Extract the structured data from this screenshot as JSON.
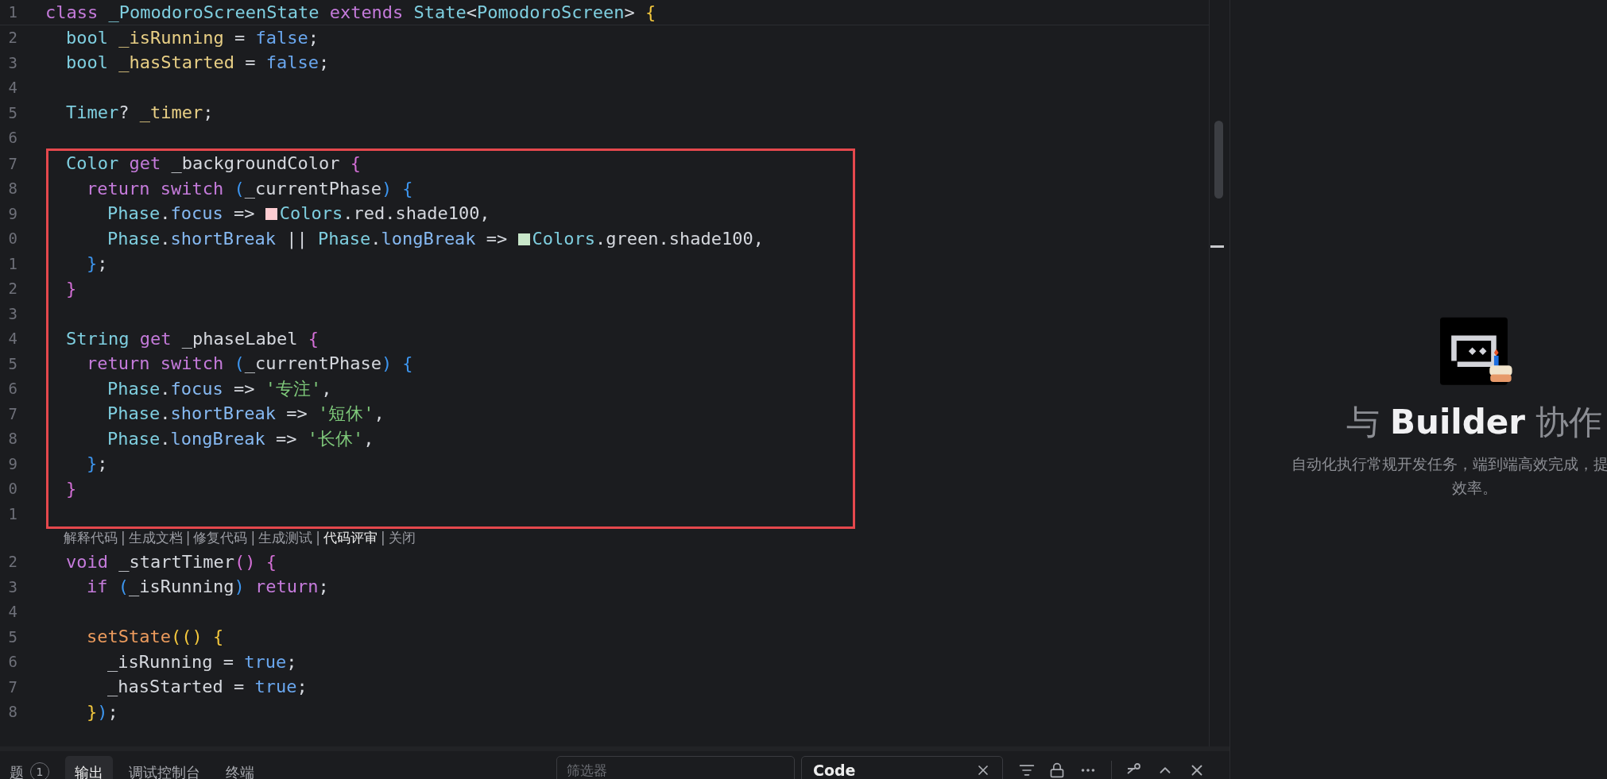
{
  "editor": {
    "sticky_line": {
      "number": "1",
      "tokens": [
        {
          "kind": "kw",
          "t": "class "
        },
        {
          "kind": "cls",
          "t": "_PomodoroScreenState "
        },
        {
          "kind": "kw",
          "t": "extends "
        },
        {
          "kind": "type",
          "t": "State"
        },
        {
          "kind": "id",
          "t": "<"
        },
        {
          "kind": "type",
          "t": "PomodoroScreen"
        },
        {
          "kind": "id",
          "t": "> "
        },
        {
          "kind": "b1",
          "t": "{"
        }
      ]
    },
    "sections": [
      {
        "kind": "plain",
        "lines": [
          {
            "number": "2",
            "tokens": [
              {
                "kind": "type",
                "t": "bool "
              },
              {
                "kind": "var",
                "t": "_isRunning"
              },
              {
                "kind": "id",
                "t": " = "
              },
              {
                "kind": "lit",
                "t": "false"
              },
              {
                "kind": "id",
                "t": ";"
              }
            ]
          },
          {
            "number": "3",
            "tokens": [
              {
                "kind": "type",
                "t": "bool "
              },
              {
                "kind": "var",
                "t": "_hasStarted"
              },
              {
                "kind": "id",
                "t": " = "
              },
              {
                "kind": "lit",
                "t": "false"
              },
              {
                "kind": "id",
                "t": ";"
              }
            ]
          },
          {
            "number": "4"
          },
          {
            "number": "5",
            "tokens": [
              {
                "kind": "type",
                "t": "Timer"
              },
              {
                "kind": "id",
                "t": "? "
              },
              {
                "kind": "var",
                "t": "_timer"
              },
              {
                "kind": "id",
                "t": ";"
              }
            ]
          },
          {
            "number": "6"
          }
        ]
      },
      {
        "kind": "highlighted",
        "lines": [
          {
            "number": "7",
            "tokens": [
              {
                "kind": "type",
                "t": "Color "
              },
              {
                "kind": "kw",
                "t": "get "
              },
              {
                "kind": "id",
                "t": "_backgroundColor "
              },
              {
                "kind": "b2",
                "t": "{"
              }
            ],
            "children": [
              {
                "number": "8",
                "tokens": [
                  {
                    "kind": "kw",
                    "t": "return switch "
                  },
                  {
                    "kind": "b3",
                    "t": "("
                  },
                  {
                    "kind": "id",
                    "t": "_currentPhase"
                  },
                  {
                    "kind": "b3",
                    "t": ") {"
                  }
                ],
                "children": [
                  {
                    "number": "9",
                    "tokens": [
                      {
                        "kind": "cls",
                        "t": "Phase"
                      },
                      {
                        "kind": "id",
                        "t": "."
                      },
                      {
                        "kind": "prop",
                        "t": "focus"
                      },
                      {
                        "kind": "id",
                        "t": " => "
                      },
                      {
                        "kind": "swatch",
                        "color": "#ffcdd2"
                      },
                      {
                        "kind": "cls",
                        "t": "Colors"
                      },
                      {
                        "kind": "id",
                        "t": ".red.shade100,"
                      }
                    ]
                  },
                  {
                    "number": "0",
                    "tokens": [
                      {
                        "kind": "cls",
                        "t": "Phase"
                      },
                      {
                        "kind": "id",
                        "t": "."
                      },
                      {
                        "kind": "prop",
                        "t": "shortBreak"
                      },
                      {
                        "kind": "id",
                        "t": " || "
                      },
                      {
                        "kind": "cls",
                        "t": "Phase"
                      },
                      {
                        "kind": "id",
                        "t": "."
                      },
                      {
                        "kind": "prop",
                        "t": "longBreak"
                      },
                      {
                        "kind": "id",
                        "t": " => "
                      },
                      {
                        "kind": "swatch",
                        "color": "#c8e6c9"
                      },
                      {
                        "kind": "cls",
                        "t": "Colors"
                      },
                      {
                        "kind": "id",
                        "t": ".green.shade100,"
                      }
                    ]
                  }
                ]
              },
              {
                "number": "1",
                "tokens": [
                  {
                    "kind": "b3",
                    "t": "}"
                  },
                  {
                    "kind": "id",
                    "t": ";"
                  }
                ]
              }
            ]
          },
          {
            "number": "2",
            "tokens": [
              {
                "kind": "b2",
                "t": "}"
              }
            ]
          },
          {
            "number": "3"
          },
          {
            "number": "4",
            "tokens": [
              {
                "kind": "type",
                "t": "String "
              },
              {
                "kind": "kw",
                "t": "get "
              },
              {
                "kind": "id",
                "t": "_phaseLabel "
              },
              {
                "kind": "b2",
                "t": "{"
              }
            ],
            "children": [
              {
                "number": "5",
                "tokens": [
                  {
                    "kind": "kw",
                    "t": "return switch "
                  },
                  {
                    "kind": "b3",
                    "t": "("
                  },
                  {
                    "kind": "id",
                    "t": "_currentPhase"
                  },
                  {
                    "kind": "b3",
                    "t": ") {"
                  }
                ],
                "children": [
                  {
                    "number": "6",
                    "tokens": [
                      {
                        "kind": "cls",
                        "t": "Phase"
                      },
                      {
                        "kind": "id",
                        "t": "."
                      },
                      {
                        "kind": "prop",
                        "t": "focus"
                      },
                      {
                        "kind": "id",
                        "t": " => "
                      },
                      {
                        "kind": "str",
                        "t": "'专注'"
                      },
                      {
                        "kind": "id",
                        "t": ","
                      }
                    ]
                  },
                  {
                    "number": "7",
                    "tokens": [
                      {
                        "kind": "cls",
                        "t": "Phase"
                      },
                      {
                        "kind": "id",
                        "t": "."
                      },
                      {
                        "kind": "prop",
                        "t": "shortBreak"
                      },
                      {
                        "kind": "id",
                        "t": " => "
                      },
                      {
                        "kind": "str",
                        "t": "'短休'"
                      },
                      {
                        "kind": "id",
                        "t": ","
                      }
                    ]
                  },
                  {
                    "number": "8",
                    "tokens": [
                      {
                        "kind": "cls",
                        "t": "Phase"
                      },
                      {
                        "kind": "id",
                        "t": "."
                      },
                      {
                        "kind": "prop",
                        "t": "longBreak"
                      },
                      {
                        "kind": "id",
                        "t": " => "
                      },
                      {
                        "kind": "str",
                        "t": "'长休'"
                      },
                      {
                        "kind": "id",
                        "t": ","
                      }
                    ]
                  }
                ]
              },
              {
                "number": "9",
                "tokens": [
                  {
                    "kind": "b3",
                    "t": "}"
                  },
                  {
                    "kind": "id",
                    "t": ";"
                  }
                ]
              }
            ]
          },
          {
            "number": "0",
            "tokens": [
              {
                "kind": "b2",
                "t": "}"
              }
            ]
          },
          {
            "number": "1"
          }
        ]
      },
      {
        "kind": "code_lens",
        "separator": "|",
        "items": [
          {
            "label": "解释代码",
            "highlighted": false
          },
          {
            "label": "生成文档",
            "highlighted": false
          },
          {
            "label": "修复代码",
            "highlighted": false
          },
          {
            "label": "生成测试",
            "highlighted": false
          },
          {
            "label": "代码评审",
            "highlighted": true
          },
          {
            "label": "关闭",
            "highlighted": false
          }
        ]
      },
      {
        "kind": "plain",
        "lines": [
          {
            "number": "2",
            "tokens": [
              {
                "kind": "kw",
                "t": "void "
              },
              {
                "kind": "id",
                "t": "_startTimer"
              },
              {
                "kind": "b2",
                "t": "() {"
              }
            ],
            "children": [
              {
                "number": "3",
                "tokens": [
                  {
                    "kind": "kw",
                    "t": "if "
                  },
                  {
                    "kind": "b3",
                    "t": "("
                  },
                  {
                    "kind": "id",
                    "t": "_isRunning"
                  },
                  {
                    "kind": "b3",
                    "t": ")"
                  },
                  {
                    "kind": "kw",
                    "t": " return"
                  },
                  {
                    "kind": "id",
                    "t": ";"
                  }
                ]
              },
              {
                "number": "4"
              },
              {
                "number": "5",
                "tokens": [
                  {
                    "kind": "fn",
                    "t": "setState"
                  },
                  {
                    "kind": "b1",
                    "t": "(() {"
                  }
                ],
                "children": [
                  {
                    "number": "6",
                    "tokens": [
                      {
                        "kind": "id",
                        "t": "_isRunning = "
                      },
                      {
                        "kind": "lit",
                        "t": "true"
                      },
                      {
                        "kind": "id",
                        "t": ";"
                      }
                    ]
                  },
                  {
                    "number": "7",
                    "tokens": [
                      {
                        "kind": "id",
                        "t": "_hasStarted = "
                      },
                      {
                        "kind": "lit",
                        "t": "true"
                      },
                      {
                        "kind": "id",
                        "t": ";"
                      }
                    ]
                  }
                ]
              },
              {
                "number": "8",
                "tokens": [
                  {
                    "kind": "b1",
                    "t": "}"
                  },
                  {
                    "kind": "b3",
                    "t": ")"
                  },
                  {
                    "kind": "id",
                    "t": ";"
                  }
                ]
              }
            ]
          }
        ]
      }
    ]
  },
  "builder_panel": {
    "title_before": "与",
    "title_bold": "Builder",
    "title_after": "协作",
    "description_lines": [
      "自动化执行常规开发任务，端到端高效完成，提",
      "效率。"
    ]
  },
  "bottom_panel": {
    "tabs": [
      {
        "label": "题",
        "badge": "1",
        "selected": false
      },
      {
        "label": "输出",
        "selected": true
      },
      {
        "label": "调试控制台",
        "selected": false
      },
      {
        "label": "终端",
        "selected": false
      }
    ],
    "filter": {
      "placeholder": "筛选器"
    },
    "dropdown": {
      "value": "Code"
    }
  }
}
